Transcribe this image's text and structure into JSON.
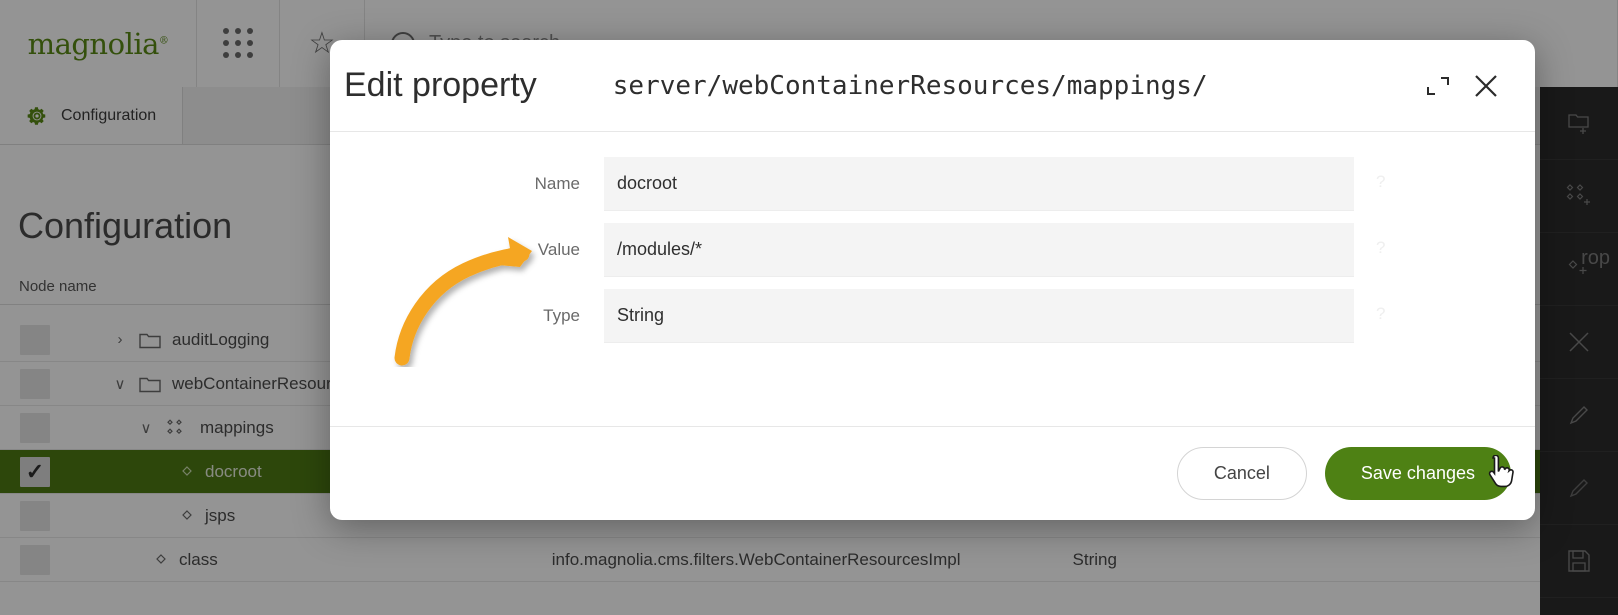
{
  "app": {
    "brand": "magnolia",
    "brand_mark": "®",
    "search_placeholder": "Type to search",
    "tabs": [
      {
        "label": "Configuration",
        "icon": "gear-icon"
      }
    ],
    "page_title": "Configuration"
  },
  "tree": {
    "columns": [
      "Node name"
    ],
    "rows": [
      {
        "label": "auditLogging",
        "icon": "folder-icon",
        "twisty": "›",
        "indent": 62,
        "selected": false,
        "checked": false,
        "value": "",
        "type": ""
      },
      {
        "label": "webContainerResources",
        "icon": "folder-icon",
        "twisty": "∨",
        "indent": 62,
        "selected": false,
        "checked": false,
        "value": "",
        "type": ""
      },
      {
        "label": "mappings",
        "icon": "content-node-icon",
        "twisty": "∨",
        "indent": 88,
        "selected": false,
        "checked": false,
        "value": "",
        "type": ""
      },
      {
        "label": "docroot",
        "icon": "property-icon",
        "twisty": "",
        "indent": 130,
        "selected": true,
        "checked": true,
        "value": "",
        "type": ""
      },
      {
        "label": "jsps",
        "icon": "property-icon",
        "twisty": "",
        "indent": 130,
        "selected": false,
        "checked": false,
        "value": "",
        "type": ""
      },
      {
        "label": "class",
        "icon": "property-icon",
        "twisty": "",
        "indent": 104,
        "selected": false,
        "checked": false,
        "value": "info.magnolia.cms.filters.WebContainerResourcesImpl",
        "type": "String"
      }
    ]
  },
  "action_bar": {
    "partial_label": "rop",
    "items": [
      {
        "name": "add-folder-icon"
      },
      {
        "name": "add-content-node-icon"
      },
      {
        "name": "add-property-icon"
      },
      {
        "name": "delete-icon"
      },
      {
        "name": "edit-icon"
      },
      {
        "name": "rename-icon"
      },
      {
        "name": "save-icon"
      }
    ]
  },
  "dialog": {
    "title": "Edit property",
    "path": "server/webContainerResources/mappings/",
    "maximize_icon": "maximize-icon",
    "close_icon": "close-icon",
    "fields": [
      {
        "label": "Name",
        "value": "docroot",
        "help": "?"
      },
      {
        "label": "Value",
        "value": "/modules/*",
        "help": "?"
      },
      {
        "label": "Type",
        "value": "String",
        "help": "?"
      }
    ],
    "cancel_label": "Cancel",
    "save_label": "Save changes"
  },
  "annotation": {
    "type": "curved-arrow",
    "color": "#F5A623",
    "points_to": "Value"
  },
  "colors": {
    "brand_green": "#5a8a16",
    "save_green": "#4e8114",
    "selected_row": "#4e7a14",
    "annotation_orange": "#F5A623",
    "field_bg": "#f4f4f4",
    "action_bar_bg": "#2b2b2b"
  }
}
